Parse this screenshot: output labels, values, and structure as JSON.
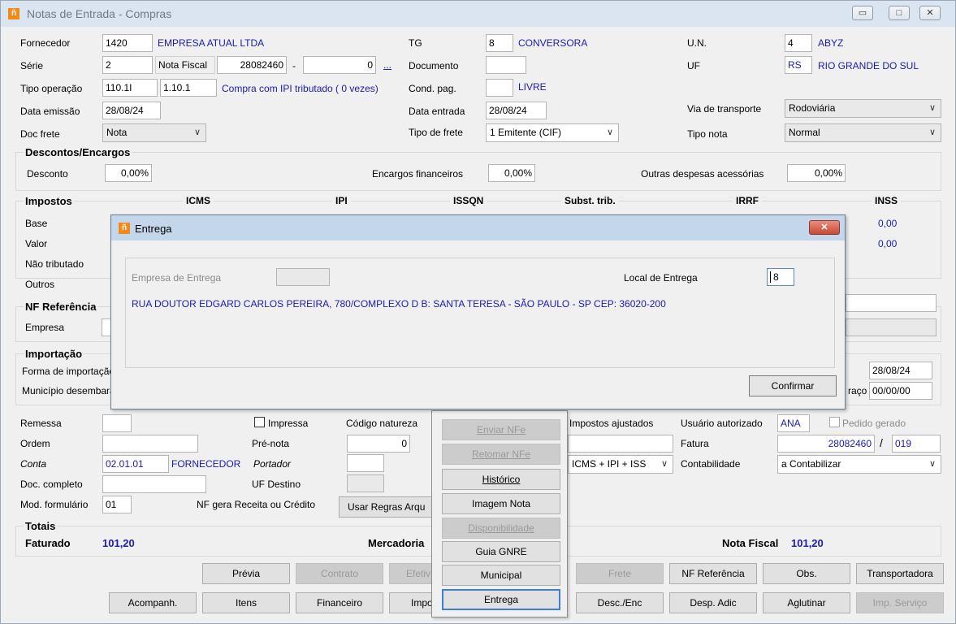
{
  "window": {
    "title": "Notas de Entrada - Compras",
    "min": "▭",
    "max": "□",
    "close": "✕"
  },
  "form": {
    "fornecedor_label": "Fornecedor",
    "fornecedor_code": "1420",
    "fornecedor_name": "EMPRESA ATUAL LTDA",
    "serie_label": "Série",
    "serie": "2",
    "nf_label": "Nota Fiscal",
    "nf": "28082460",
    "dash": "-",
    "nf2": "0",
    "ellipsis": "...",
    "tipoop_label": "Tipo operação",
    "tipoop1": "110.1I",
    "tipoop2": "1.10.1",
    "tipoop_desc": "Compra com IPI tributado ( 0 vezes)",
    "dataemissao_label": "Data emissão",
    "dataemissao": "28/08/24",
    "docfrete_label": "Doc frete",
    "docfrete": "Nota",
    "tg_label": "TG",
    "tg": "8",
    "tg_desc": "CONVERSORA",
    "documento_label": "Documento",
    "documento": "",
    "condpag_label": "Cond. pag.",
    "condpag": "",
    "condpag_desc": "LIVRE",
    "dataentrada_label": "Data entrada",
    "dataentrada": "28/08/24",
    "tipofrete_label": "Tipo de frete",
    "tipofrete": "1 Emitente (CIF)",
    "un_label": "U.N.",
    "un": "4",
    "un_desc": "ABYZ",
    "uf_label": "UF",
    "uf": "RS",
    "uf_desc": "RIO GRANDE DO SUL",
    "via_label": "Via de transporte",
    "via": "Rodoviária",
    "tiponota_label": "Tipo nota",
    "tiponota": "Normal"
  },
  "descontos": {
    "title": "Descontos/Encargos",
    "desconto_label": "Desconto",
    "desconto": "0,00%",
    "encargos_label": "Encargos financeiros",
    "encargos": "0,00%",
    "outras_label": "Outras despesas acessórias",
    "outras": "0,00%"
  },
  "impostos": {
    "title": "Impostos",
    "cols": [
      "ICMS",
      "IPI",
      "ISSQN",
      "Subst. trib.",
      "IRRF",
      "INSS"
    ],
    "rows": [
      "Base",
      "Valor",
      "Não tributado",
      "Outros"
    ],
    "inss_base": "0,00",
    "inss_valor": "0,00"
  },
  "nfref": {
    "title": "NF Referência",
    "empresa_label": "Empresa"
  },
  "importacao": {
    "title": "Importação",
    "forma_label": "Forma de importação",
    "municipio_label": "Município desembaraço",
    "date1": "28/08/24",
    "desemb_suffix": "raço",
    "date2": "00/00/00"
  },
  "lower": {
    "remessa_label": "Remessa",
    "ordem_label": "Ordem",
    "conta_label": "Conta",
    "conta": "02.01.01",
    "conta_desc": "FORNECEDOR",
    "doc_label": "Doc. completo",
    "mod_label": "Mod. formulário",
    "mod": "01",
    "impressa_label": "Impressa",
    "prenota_label": "Pré-nota",
    "portador_label": "Portador",
    "ufdestino_label": "UF Destino",
    "codnat_label": "Código natureza",
    "prenota": "0",
    "gera_label": "NF gera Receita ou Crédito",
    "gera": "Usar Regras Arqu",
    "impajust_label": "Impostos ajustados",
    "impajust": "ICMS + IPI + ISS",
    "usuario_label": "Usuário autorizado",
    "usuario": "ANA",
    "pedido_label": "Pedido gerado",
    "fatura_label": "Fatura",
    "fatura": "28082460",
    "slash": "/",
    "fatura2": "019",
    "contab_label": "Contabilidade",
    "contab": "a Contabilizar"
  },
  "totais": {
    "title": "Totais",
    "faturado_label": "Faturado",
    "faturado": "101,20",
    "mercadoria_label": "Mercadoria",
    "notafiscal_label": "Nota Fiscal",
    "notafiscal": "101,20"
  },
  "buttons": {
    "previa": "Prévia",
    "contrato": "Contrato",
    "efetiv": "Efetiv",
    "frete": "Frete",
    "nfref": "NF Referência",
    "obs": "Obs.",
    "transportadora": "Transportadora",
    "acompanh": "Acompanh.",
    "itens": "Itens",
    "financeiro": "Financeiro",
    "impo": "Impo",
    "desc": "Desc./Enc",
    "desp": "Desp. Adic",
    "aglutinar": "Aglutinar",
    "impservico": "Imp. Serviço"
  },
  "popup": {
    "items": [
      "Enviar NFe",
      "Retomar NFe",
      "Histórico",
      "Imagem Nota",
      "Disponibilidade",
      "Guia GNRE",
      "Municipal",
      "Entrega"
    ]
  },
  "dialog": {
    "title": "Entrega",
    "close": "✕",
    "empresa_label": "Empresa de Entrega",
    "empresa": "",
    "local_label": "Local de Entrega",
    "local": "8",
    "address": "RUA DOUTOR EDGARD CARLOS PEREIRA, 780/COMPLEXO D B: SANTA TERESA - SÃO PAULO - SP CEP: 36020-200",
    "confirm": "Confirmar"
  }
}
